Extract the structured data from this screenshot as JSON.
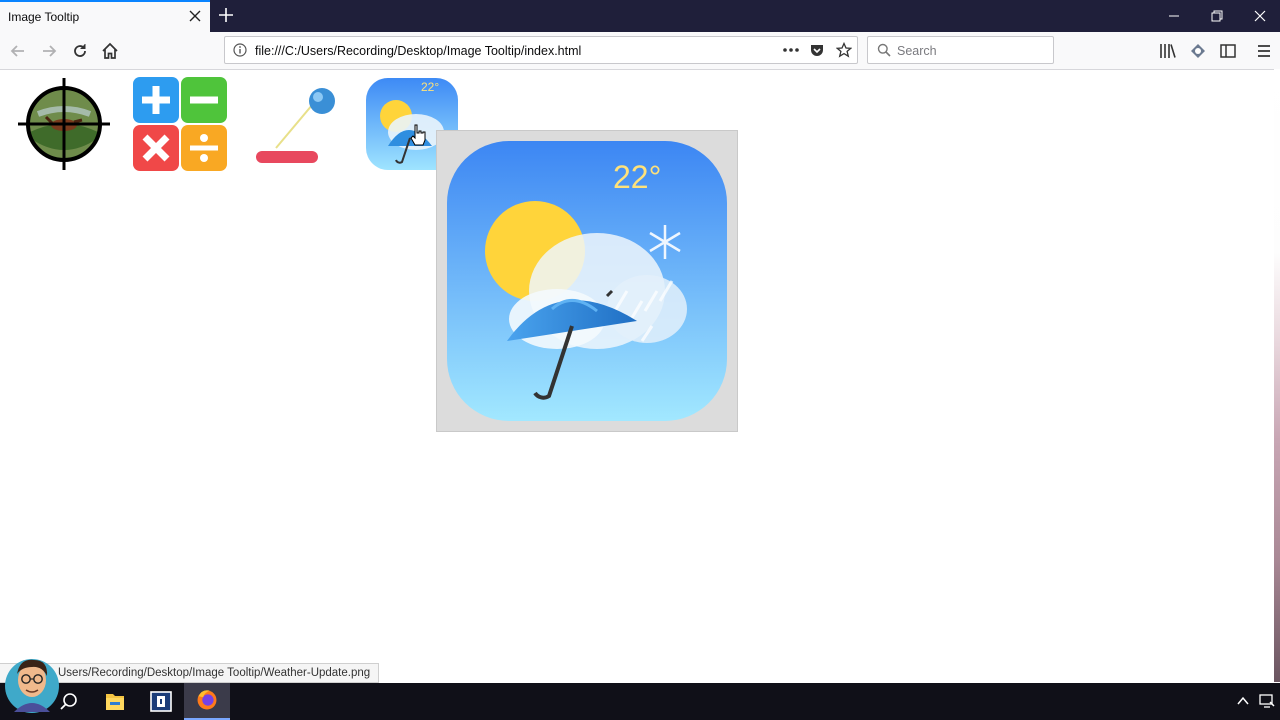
{
  "browser": {
    "tab_title": "Image Tooltip",
    "url": "file:///C:/Users/Recording/Desktop/Image Tooltip/index.html",
    "search_placeholder": "Search"
  },
  "page": {
    "thumbnails": [
      {
        "name": "duck-hunt-icon"
      },
      {
        "name": "calculator-icon"
      },
      {
        "name": "pinball-paddle-icon"
      },
      {
        "name": "weather-update-icon"
      }
    ],
    "tooltip": {
      "temperature": "22°"
    },
    "thumbnail_temperature": "22°"
  },
  "status": {
    "text": "Users/Recording/Desktop/Image Tooltip/Weather-Update.png"
  },
  "colors": {
    "accent": "#0a84ff",
    "titlebar": "#1f1f3a",
    "taskbar": "#101018"
  }
}
